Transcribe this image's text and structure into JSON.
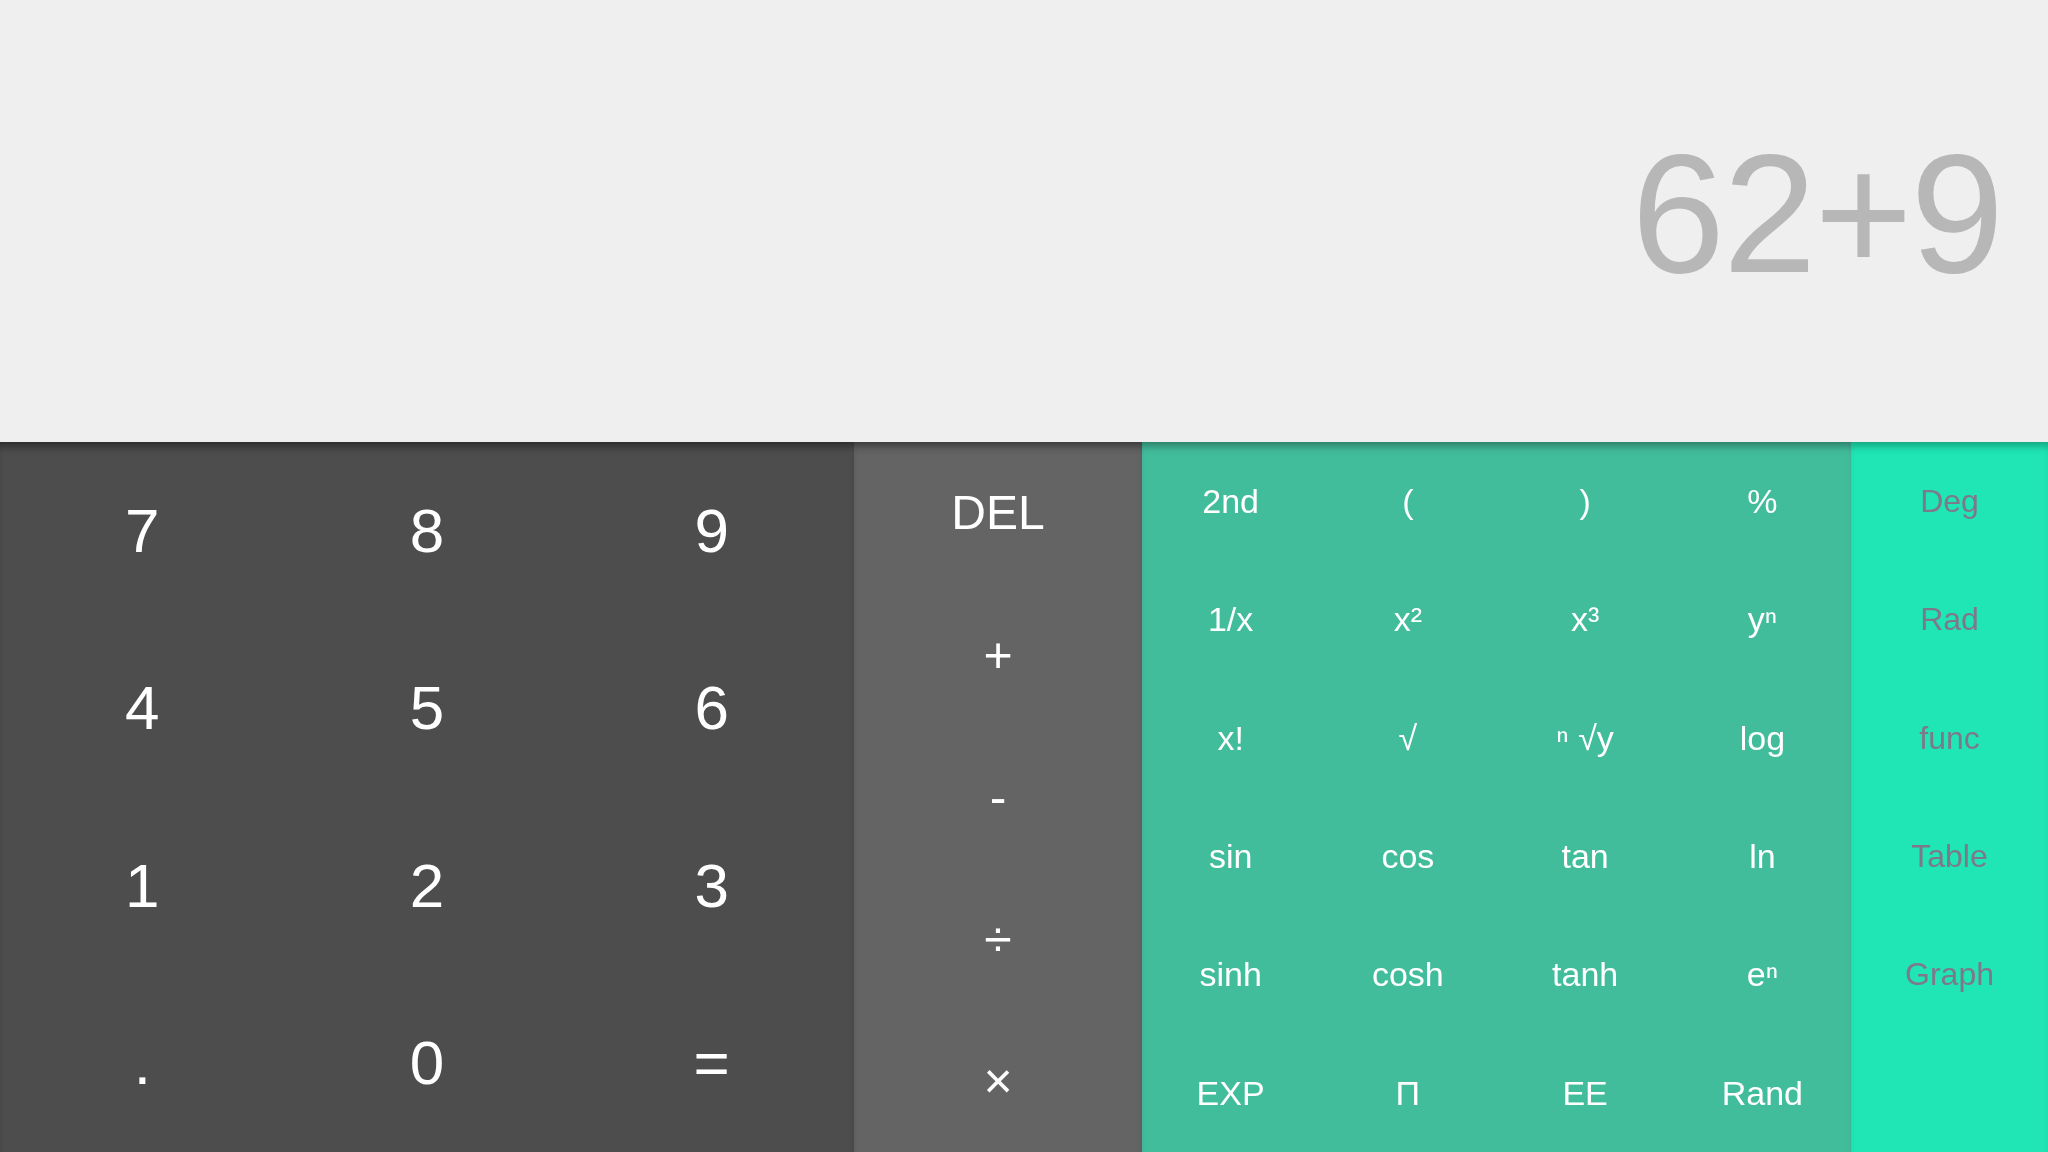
{
  "display": {
    "expression": "62+9"
  },
  "number_pad": {
    "keys": [
      "7",
      "8",
      "9",
      "4",
      "5",
      "6",
      "1",
      "2",
      "3",
      ".",
      "0",
      "="
    ]
  },
  "operators": {
    "keys": [
      "DEL",
      "+",
      "-",
      "÷",
      "×"
    ]
  },
  "functions": {
    "keys": [
      "2nd",
      "(",
      ")",
      "%",
      "1/x",
      "x²",
      "x³",
      "yⁿ",
      "x!",
      "√",
      "ⁿ √y",
      "log",
      "sin",
      "cos",
      "tan",
      "ln",
      "sinh",
      "cosh",
      "tanh",
      "eⁿ",
      "EXP",
      "Π",
      "EE",
      "Rand"
    ]
  },
  "modes": {
    "keys": [
      "Deg",
      "Rad",
      "func",
      "Table",
      "Graph"
    ]
  }
}
